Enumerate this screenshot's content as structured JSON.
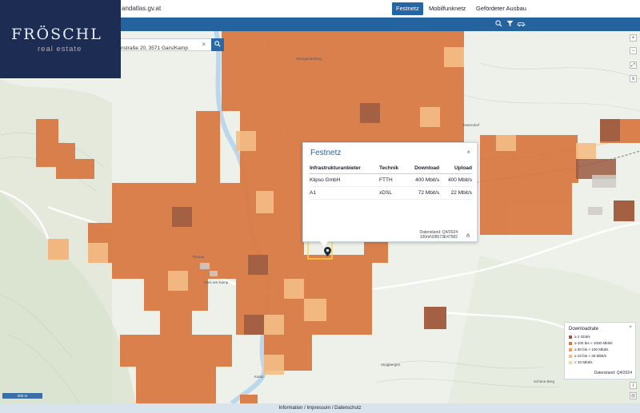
{
  "header": {
    "site_url": "andatlas.gv.at",
    "tabs": [
      {
        "label": "Festnetz",
        "active": true
      },
      {
        "label": "Mobilfunknetz",
        "active": false
      },
      {
        "label": "Gefördeter Ausbau",
        "active": false
      }
    ]
  },
  "toolbar": {
    "color": "#24639e",
    "icons": [
      "search-icon",
      "filter-icon",
      "car-icon"
    ]
  },
  "logo": {
    "name": "FRÖSCHL",
    "sub": "real estate"
  },
  "search": {
    "value": "nstraße 20, 3571 Gars/Kamp",
    "clear": "×",
    "button_icon": "search-icon"
  },
  "popup": {
    "title": "Festnetz",
    "close": "×",
    "columns": [
      "Infrastrukturanbieter",
      "Technik",
      "Download",
      "Upload"
    ],
    "rows": [
      {
        "provider": "Klipso GmbH",
        "tech": "FTTH",
        "down": "400 Mbit/s",
        "up": "400 Mbit/s"
      },
      {
        "provider": "A1",
        "tech": "xDSL",
        "down": "72 Mbit/s",
        "up": "22 Mbit/s"
      }
    ],
    "note_line1": "Datenstand: Q4/2024",
    "note_line2": "100mN28673E47582"
  },
  "legend": {
    "title": "Downloadrate",
    "close": "×",
    "items": [
      {
        "label": "≥ 1 Gbit/s",
        "color": "#9a5a41"
      },
      {
        "label": "≥ 100 bis < 1000 Mbit/s",
        "color": "#d9773f"
      },
      {
        "label": "≥ 30 bis < 100 Mbit/s",
        "color": "#ef9a5e"
      },
      {
        "label": "≥ 10 bis < 30 Mbit/s",
        "color": "#f5bd86"
      },
      {
        "label": "< 10 Mbit/s",
        "color": "#f7d6a9"
      }
    ],
    "date": "Datenstand: Q4/2024"
  },
  "map_labels": [
    "Weingartenberg",
    "Tautendorf",
    "Gars am Kamp",
    "Thunau",
    "Kamp",
    "Steigbergen",
    "Schöne Berg"
  ],
  "scale": "200 m",
  "footer": "Information / Impressum / Datenschutz"
}
